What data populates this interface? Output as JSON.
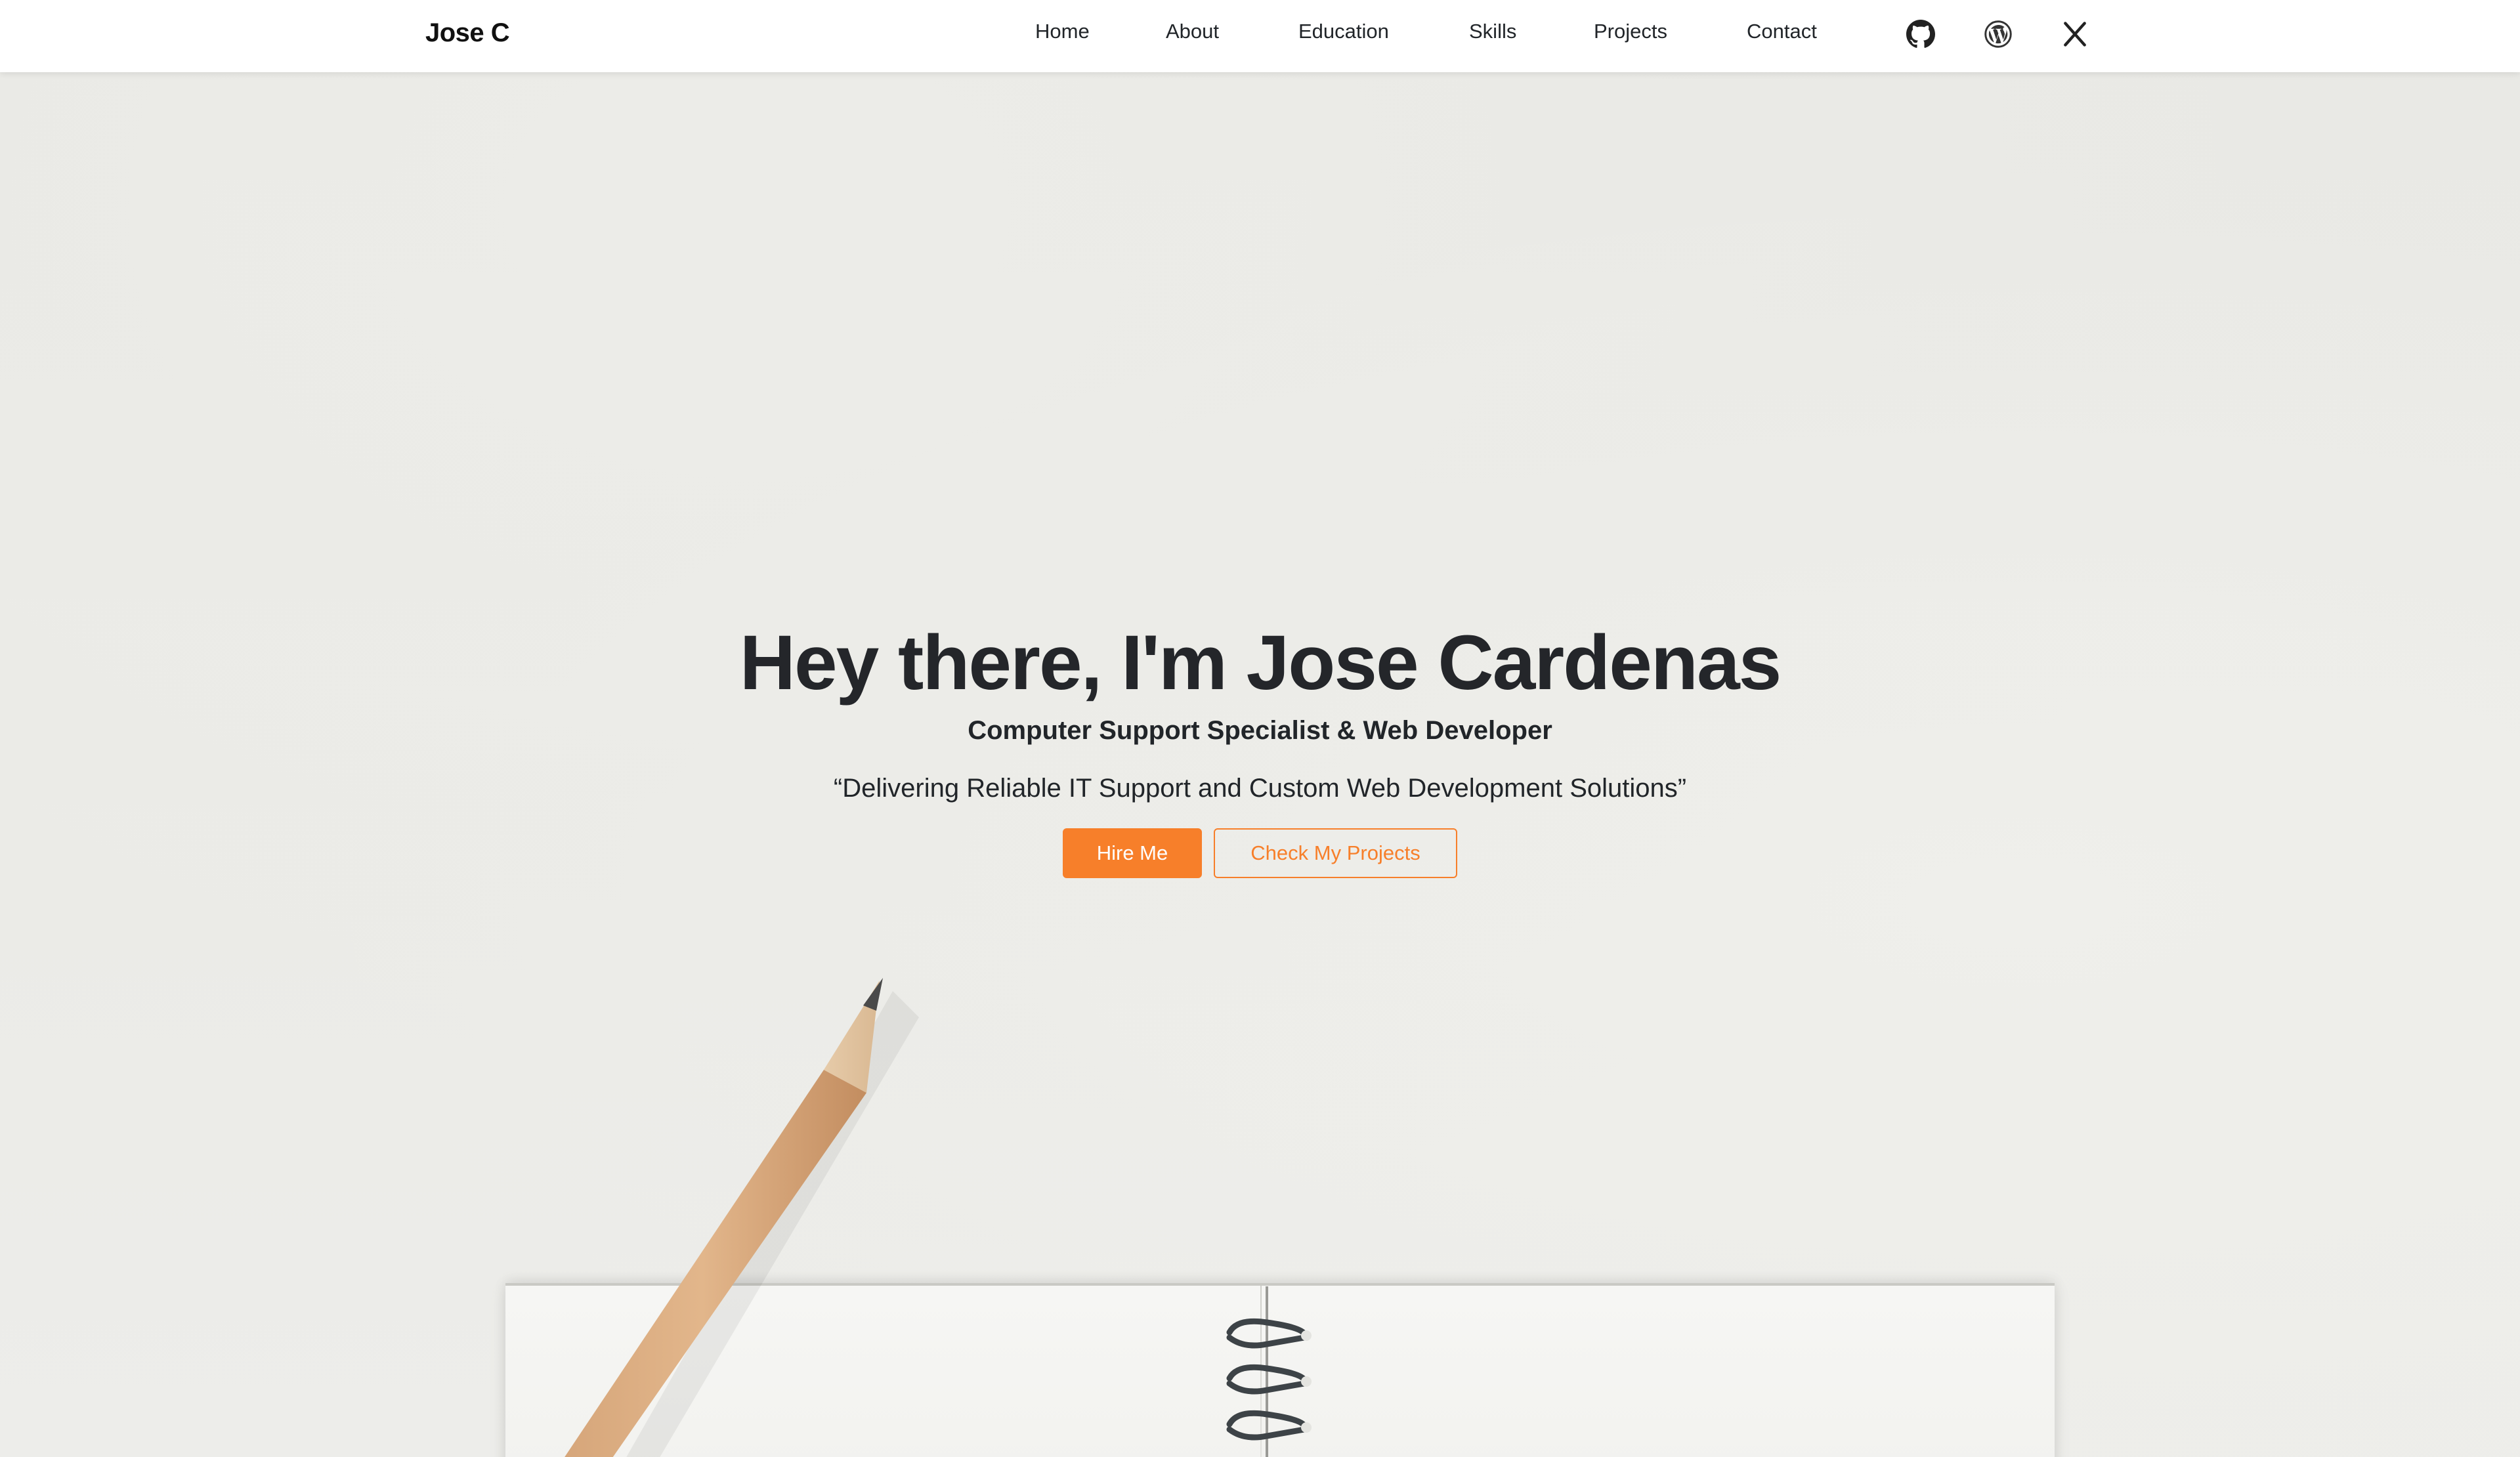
{
  "brand": "Jose C",
  "nav": {
    "links": [
      "Home",
      "About",
      "Education",
      "Skills",
      "Projects",
      "Contact"
    ]
  },
  "social": [
    {
      "name": "github-icon"
    },
    {
      "name": "wordpress-icon"
    },
    {
      "name": "x-icon"
    }
  ],
  "hero": {
    "title": "Hey there, I'm Jose Cardenas",
    "subtitle": "Computer Support Specialist & Web Developer",
    "quote": "“Delivering Reliable IT Support and Custom Web Development Solutions”",
    "primary_button": "Hire Me",
    "secondary_button": "Check My Projects"
  },
  "colors": {
    "accent": "#f77f2a",
    "text": "#24262a",
    "navbar": "#ffffff",
    "background": "#eaeae6"
  }
}
